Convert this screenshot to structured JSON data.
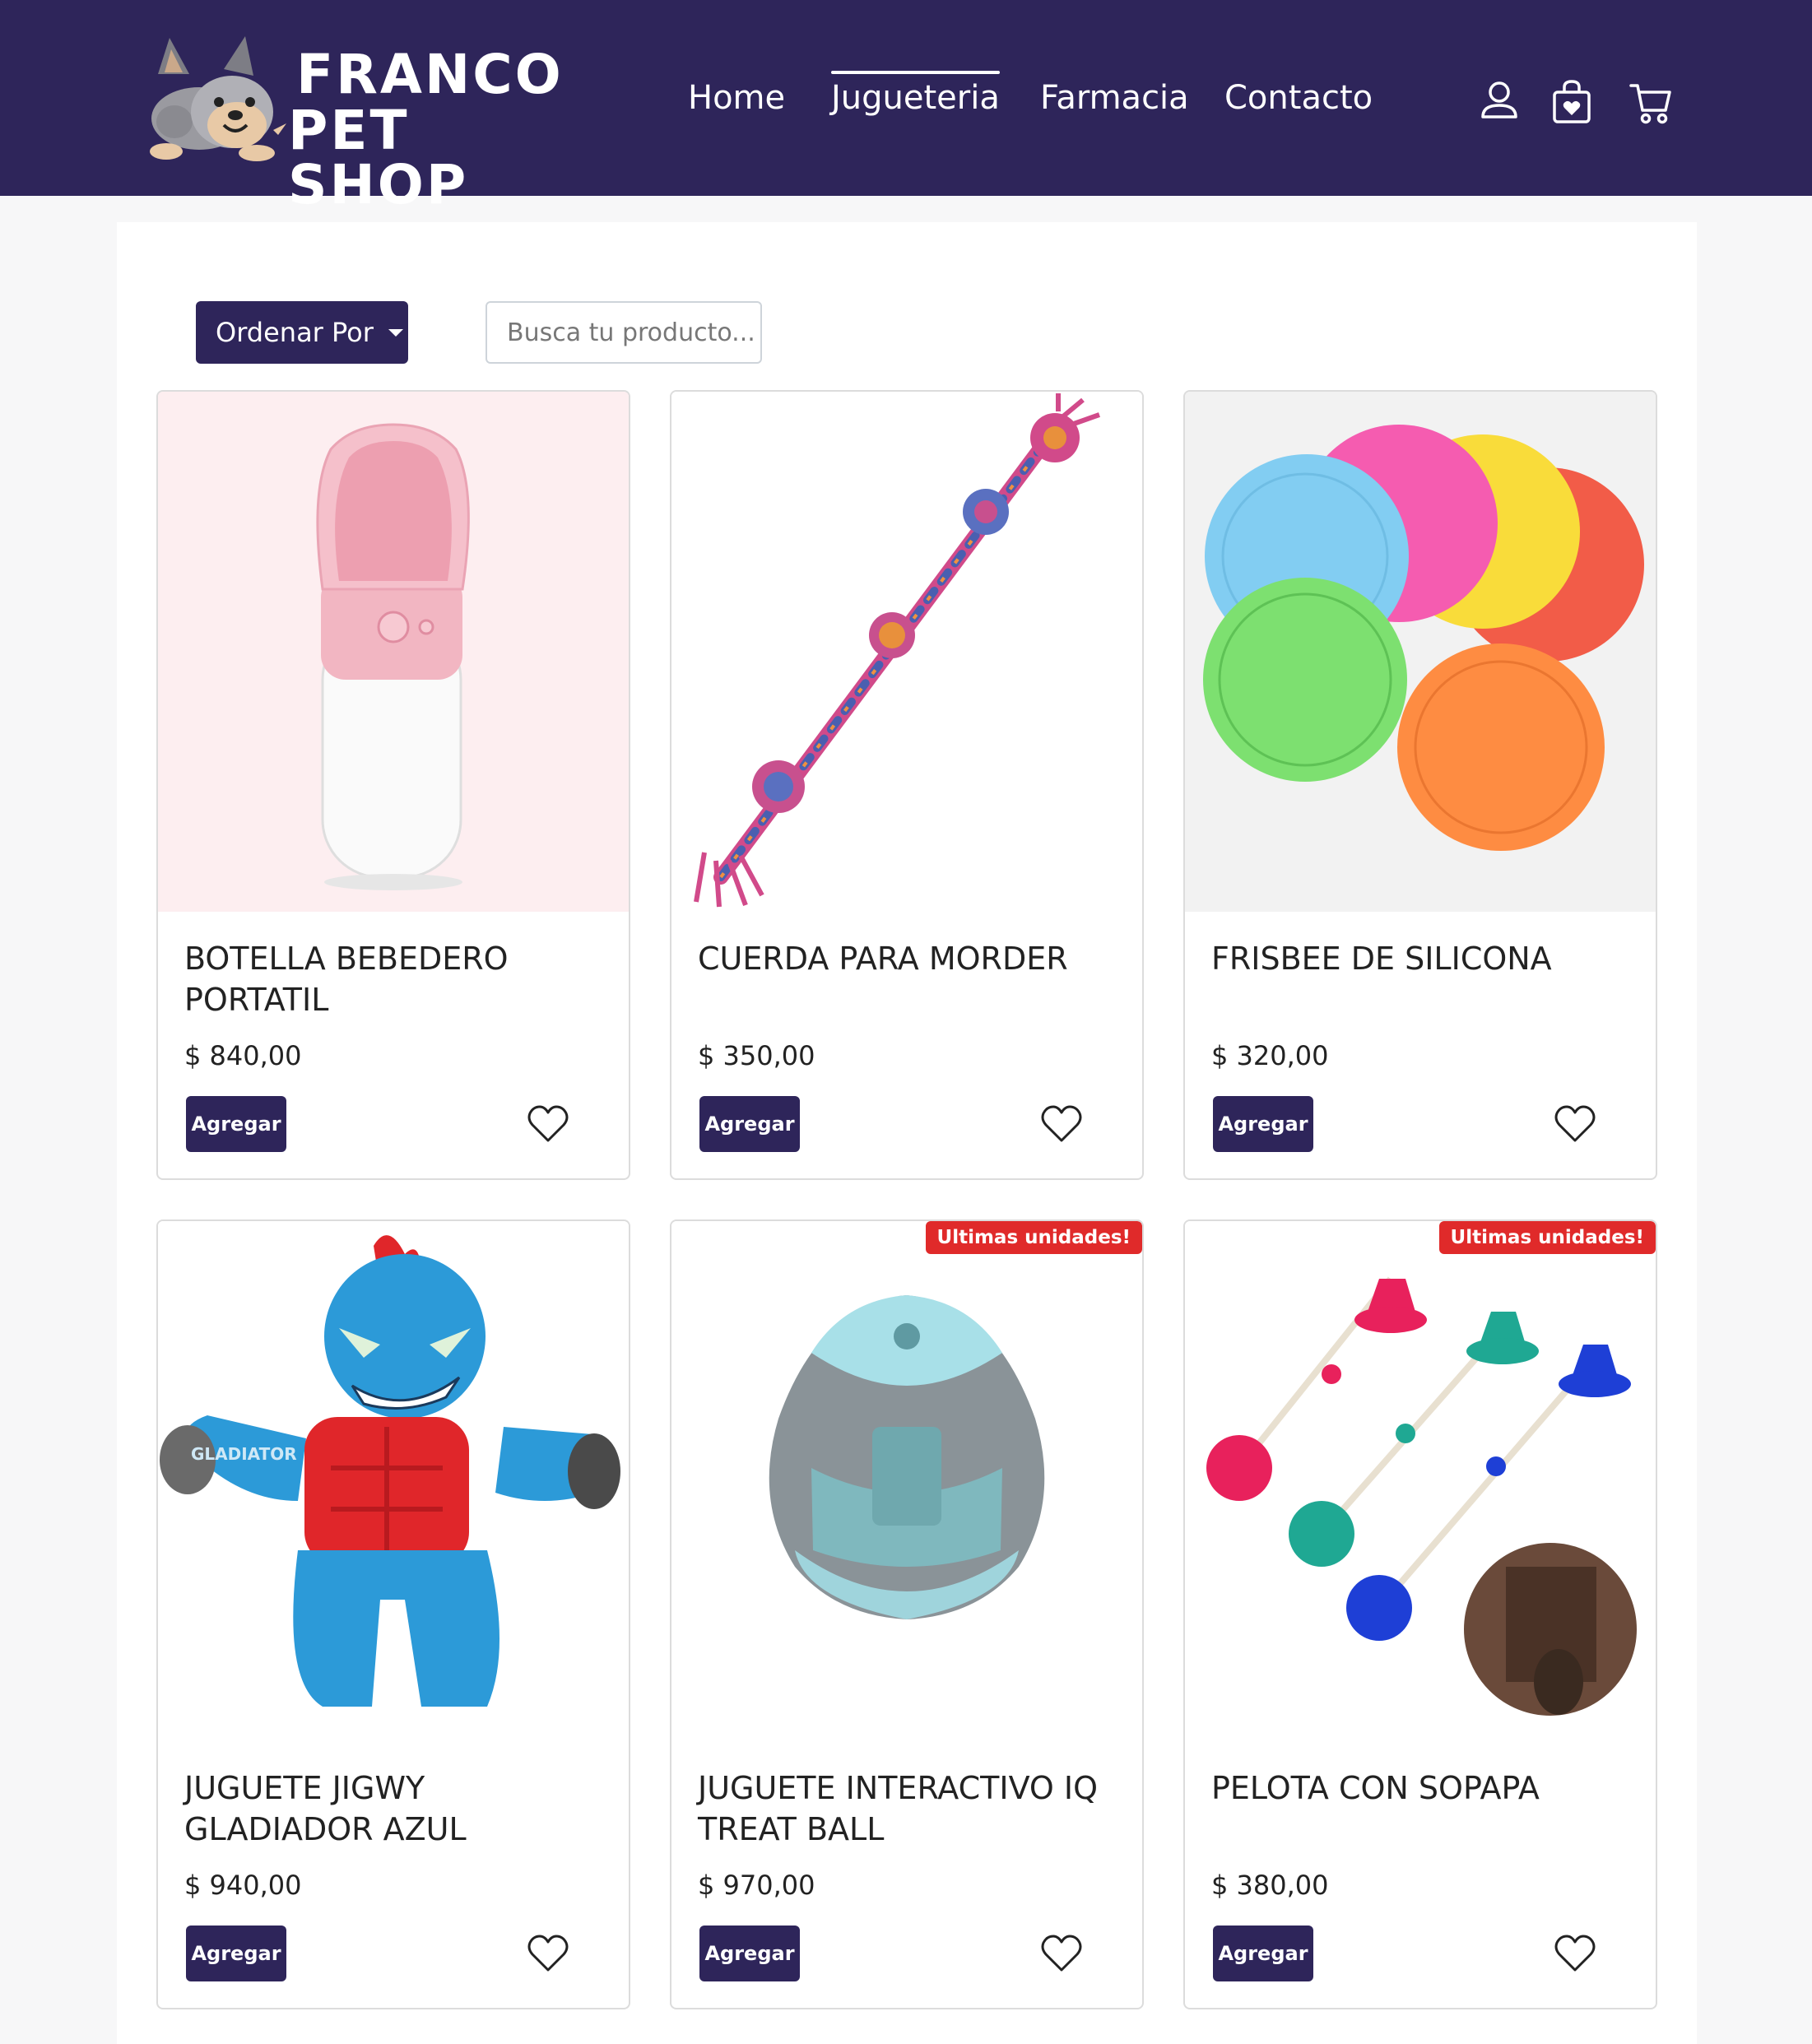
{
  "brand": {
    "line1": "FRANCO",
    "line2": "PET SHOP",
    "logo_icon": "dog-mascot-logo"
  },
  "nav": {
    "links": [
      "Home",
      "Jugueteria",
      "Farmacia",
      "Contacto"
    ],
    "active": "Jugueteria",
    "icons": [
      "user-icon",
      "favorites-bag-icon",
      "cart-icon"
    ]
  },
  "toolbar": {
    "sort_label": "Ordenar Por",
    "search_placeholder": "Busca tu producto..."
  },
  "colors": {
    "brand": "#2e255a",
    "badge": "#e02a2a",
    "white": "#ffffff"
  },
  "products": [
    {
      "title": "BOTELLA BEBEDERO PORTATIL",
      "price": "$ 840,00",
      "add_label": "Agregar",
      "badge": "",
      "image": "pink-water-bottle"
    },
    {
      "title": "CUERDA PARA MORDER",
      "price": "$ 350,00",
      "add_label": "Agregar",
      "badge": "",
      "image": "knotted-rope-toy"
    },
    {
      "title": "FRISBEE DE SILICONA",
      "price": "$ 320,00",
      "add_label": "Agregar",
      "badge": "",
      "image": "silicone-frisbees"
    },
    {
      "title": "JUGUETE JIGWY GLADIADOR AZUL",
      "price": "$ 940,00",
      "add_label": "Agregar",
      "badge": "",
      "image": "blue-gladiator-plush"
    },
    {
      "title": "JUGUETE INTERACTIVO IQ TREAT BALL",
      "price": "$ 970,00",
      "add_label": "Agregar",
      "badge": "Ultimas unidades!",
      "image": "treat-ball-egg"
    },
    {
      "title": "PELOTA CON SOPAPA",
      "price": "$ 380,00",
      "add_label": "Agregar",
      "badge": "Ultimas unidades!",
      "image": "suction-ball-toys"
    }
  ]
}
